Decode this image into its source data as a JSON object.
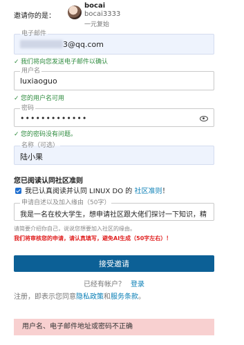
{
  "inviter": {
    "label": "邀请你的是：",
    "name": "bocai",
    "handle": "bocai3333",
    "trust_level": "一元复始"
  },
  "email": {
    "label": "电子邮件",
    "value_suffix": "3@qq.com",
    "hint": "我们将向您发送电子邮件以确认"
  },
  "username": {
    "label": "用户名",
    "value": "luxiaoguo",
    "hint": "您的用户名可用"
  },
  "password": {
    "label": "密码",
    "value": "•••••••••••••",
    "hint": "您的密码没有问题。"
  },
  "name": {
    "label": "名称（可选）",
    "value": "陆小果"
  },
  "guidelines": {
    "title": "您已阅读认同社区准则",
    "agree_text": "我已认真阅读并认同 LINUX DO 的 ",
    "agree_link": "社区准则",
    "agree_end": "！"
  },
  "reason": {
    "label": "申请自述以及加入缘由（50字）",
    "value": "我是一名在校大学生，想申请社区跟大佬们探讨一下知识，精",
    "help": "请简要介绍你自己，说说您想要加入社区的缘由。",
    "warning": "我们将审核您的申请，请认真填写，避免AI生成（50字左右）！"
  },
  "accept_button": "接受邀请",
  "login_prompt": {
    "text": "已经有帐户？",
    "link": "登录"
  },
  "terms": {
    "prefix": "注册，即表示您同意",
    "privacy": "隐私政策",
    "and": "和",
    "tos": "服务条款",
    "end": "。"
  },
  "error": "用户名、电子邮件地址或密码不正确",
  "colors": {
    "primary": "#0c6096",
    "success": "#2e8b3e",
    "link": "#0a7fb6",
    "danger": "#e02020",
    "error_bg": "#f8d0d0"
  }
}
